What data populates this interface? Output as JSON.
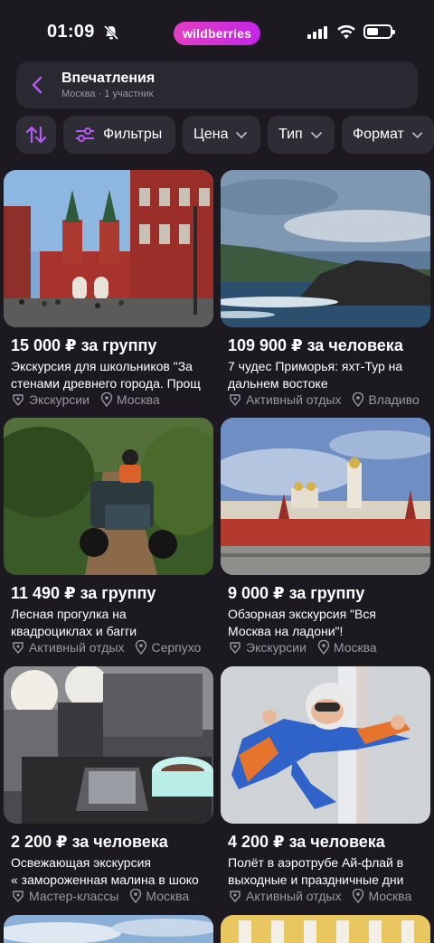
{
  "status": {
    "time": "01:09",
    "brand": "wildberries"
  },
  "header": {
    "title": "Впечатления",
    "subtitle": "Москва · 1 участник"
  },
  "filters": {
    "filters_label": "Фильтры",
    "price_label": "Цена",
    "type_label": "Тип",
    "format_label": "Формат"
  },
  "cards": [
    {
      "price": "15 000 ₽ за группу",
      "title1": "Экскурсия для школьников \"За",
      "title2": "стенами древнего города. Прощ",
      "category": "Экскурсии",
      "city": "Москва"
    },
    {
      "price": "109 900 ₽ за человека",
      "title1": "7 чудес Приморья: яхт-Тур на",
      "title2": "дальнем востоке",
      "category": "Активный отдых",
      "city": "Владиво"
    },
    {
      "price": "11 490 ₽ за группу",
      "title1": "Лесная прогулка на",
      "title2": "квадроциклах и багги",
      "category": "Активный отдых",
      "city": "Серпухо"
    },
    {
      "price": "9 000 ₽ за группу",
      "title1": "Обзорная экскурсия \"Вся",
      "title2": "Москва на ладони\"!",
      "category": "Экскурсии",
      "city": "Москва"
    },
    {
      "price": "2 200 ₽ за человека",
      "title1": "Освежающая экскурсия",
      "title2": "« замороженная малина в шоко",
      "category": "Мастер-классы",
      "city": "Москва"
    },
    {
      "price": "4 200 ₽ за человека",
      "title1": "Полёт в аэротрубе Ай-флай в",
      "title2": "выходные и праздничные дни",
      "category": "Активный отдых",
      "city": "Москва"
    }
  ],
  "colors": {
    "background": "#1c1a20",
    "surface": "#2e2c34",
    "accent": "#b45cf2",
    "brand_gradient": [
      "#e43ec4",
      "#c226e6"
    ]
  },
  "icons": {
    "sort": "sort-arrows-icon",
    "filters": "sliders-icon",
    "chevron": "chevron-down-icon",
    "category": "tag-icon",
    "location": "pin-icon"
  }
}
